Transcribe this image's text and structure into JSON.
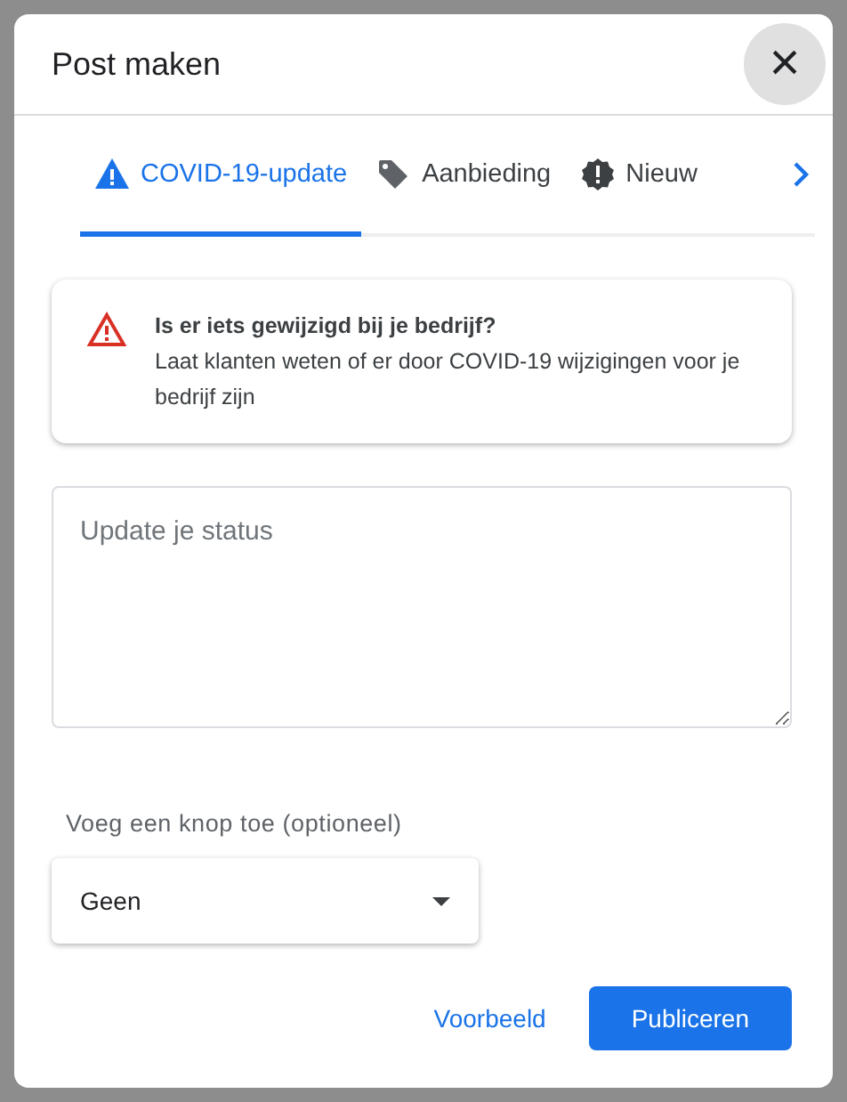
{
  "dialog": {
    "title": "Post maken",
    "close": "×"
  },
  "tabs": [
    {
      "label": "COVID-19-update",
      "kind": "warning",
      "selected": true
    },
    {
      "label": "Aanbieding",
      "kind": "tag",
      "selected": false
    },
    {
      "label": "Nieuw",
      "kind": "news",
      "selected": false
    }
  ],
  "notice": {
    "heading": "Is er iets gewijzigd bij je bedrijf?",
    "body": "Laat klanten weten of er door COVID-19 wijzigingen voor je bedrijf zijn"
  },
  "status_field": {
    "placeholder": "Update je status"
  },
  "button_select": {
    "label": "Voeg een knop toe (optioneel)",
    "value": "Geen"
  },
  "actions": [
    {
      "label": "Voorbeeld",
      "kind": "text"
    },
    {
      "label": "Publiceren",
      "kind": "primary"
    }
  ]
}
